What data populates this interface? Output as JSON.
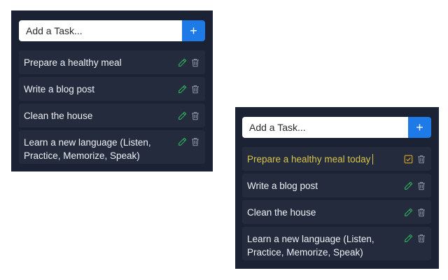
{
  "left": {
    "add_placeholder": "Add a Task...",
    "add_button_label": "+",
    "tasks": [
      {
        "text": "Prepare a healthy meal"
      },
      {
        "text": "Write a blog post"
      },
      {
        "text": "Clean the house"
      },
      {
        "text": "Learn a new language (Listen, Practice, Memorize, Speak)"
      }
    ]
  },
  "right": {
    "add_placeholder": "Add a Task...",
    "add_button_label": "+",
    "tasks": [
      {
        "text": "Prepare a healthy meal today",
        "editing": true
      },
      {
        "text": "Write a blog post"
      },
      {
        "text": "Clean the house"
      },
      {
        "text": "Learn a new language (Listen, Practice, Memorize, Speak)"
      }
    ]
  },
  "icons": {
    "edit": "pencil-icon",
    "save": "check-square-icon",
    "delete": "trash-icon"
  },
  "colors": {
    "panel_bg": "#1b2233",
    "task_bg": "#232b3d",
    "accent_blue": "#1e7ae6",
    "edit_green": "#2eaa5c",
    "editing_yellow": "#d9c44a",
    "trash_gray": "#8b93a3"
  }
}
